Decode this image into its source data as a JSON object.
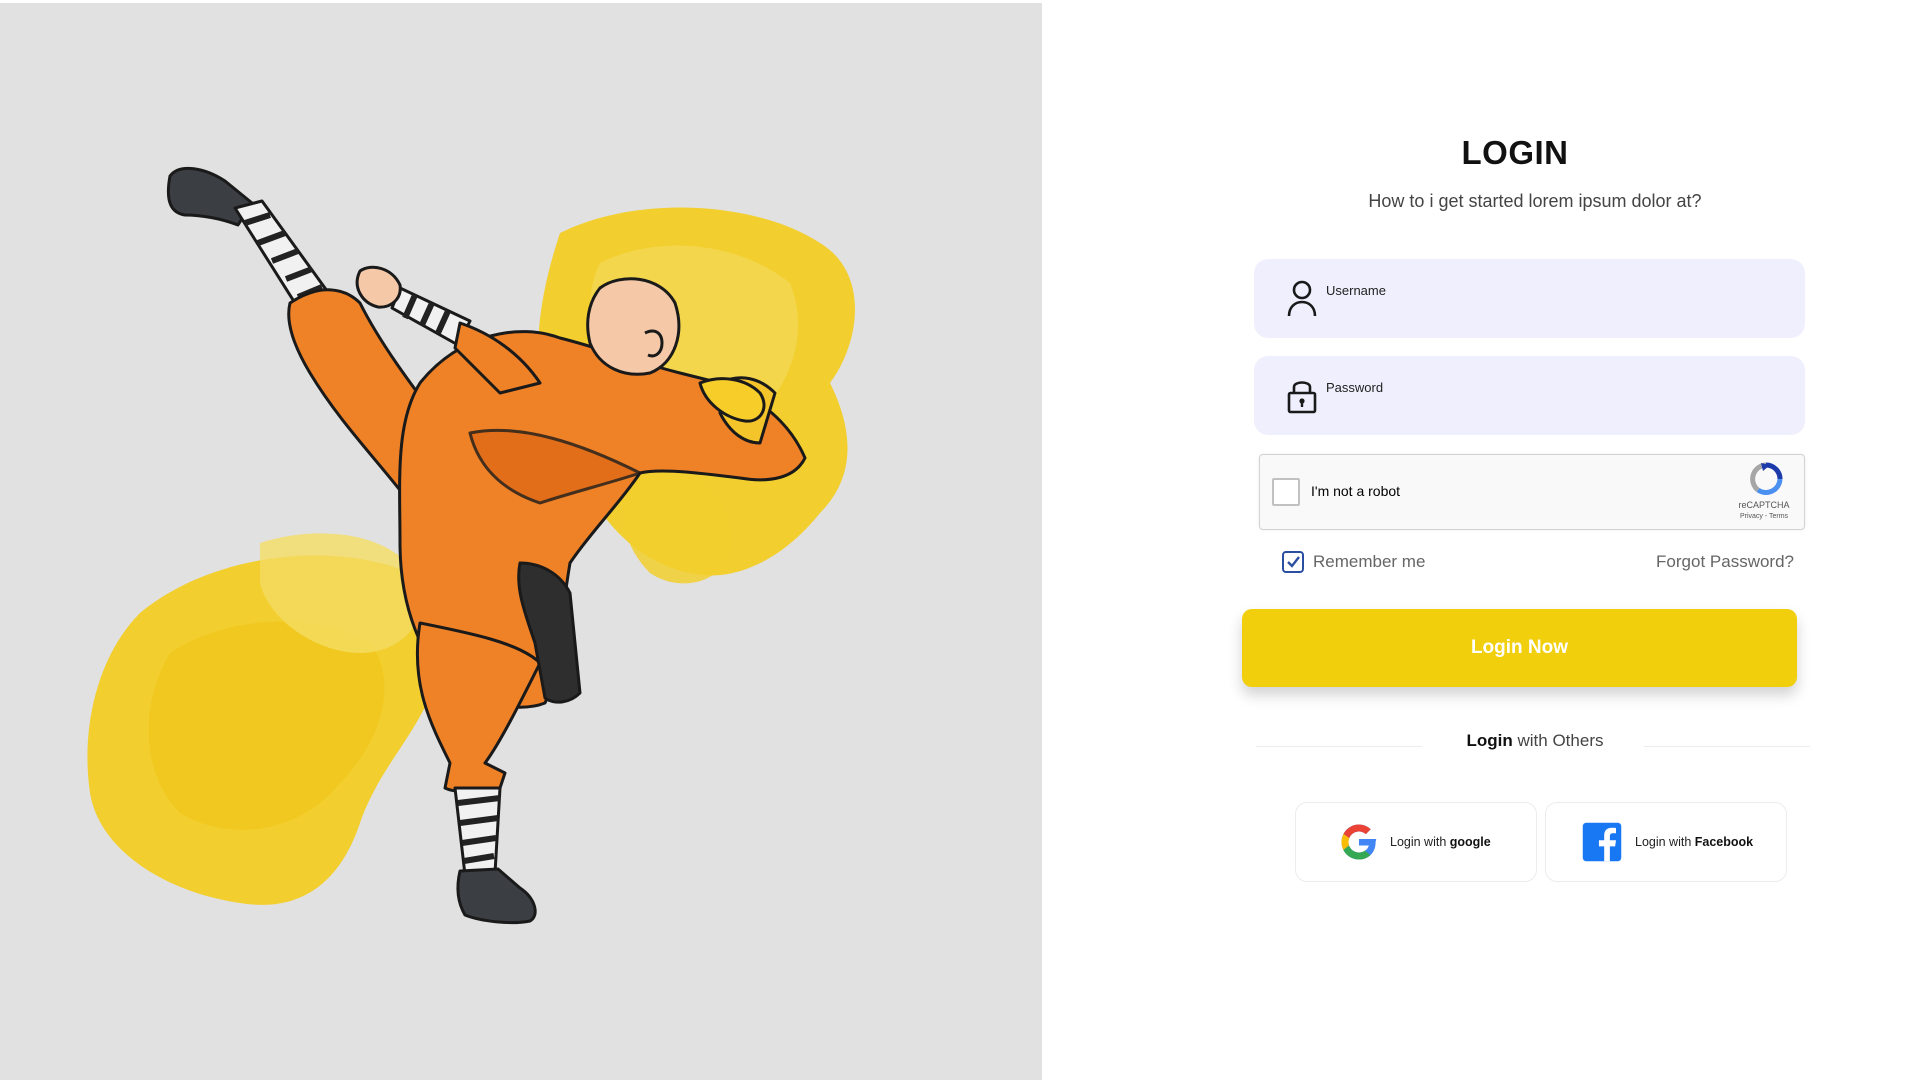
{
  "login": {
    "title": "LOGIN",
    "subtitle": "How to i get started lorem ipsum dolor at?"
  },
  "username": {
    "placeholder": "Username"
  },
  "password": {
    "placeholder": "Password"
  },
  "captcha": {
    "label": "I'm not a robot",
    "brand": "reCAPTCHA",
    "terms": "Privacy - Terms"
  },
  "remember": {
    "label": "Remember me",
    "checked": true
  },
  "forgot": {
    "label": "Forgot Password?"
  },
  "submit": {
    "label": "Login Now"
  },
  "others": {
    "bold": "Login",
    "rest": " with Others"
  },
  "social": {
    "google": {
      "prefix": "Login with ",
      "brand": "google"
    },
    "facebook": {
      "prefix": "Login with ",
      "brand": "Facebook"
    }
  },
  "colors": {
    "accent": "#f1cf0c",
    "field_bg": "#f0effd",
    "panel_bg": "#e1e1e1",
    "robe": "#ef8127"
  },
  "icons": [
    "user-icon",
    "lock-icon",
    "recaptcha-icon",
    "checkmark-icon",
    "google-icon",
    "facebook-icon"
  ]
}
